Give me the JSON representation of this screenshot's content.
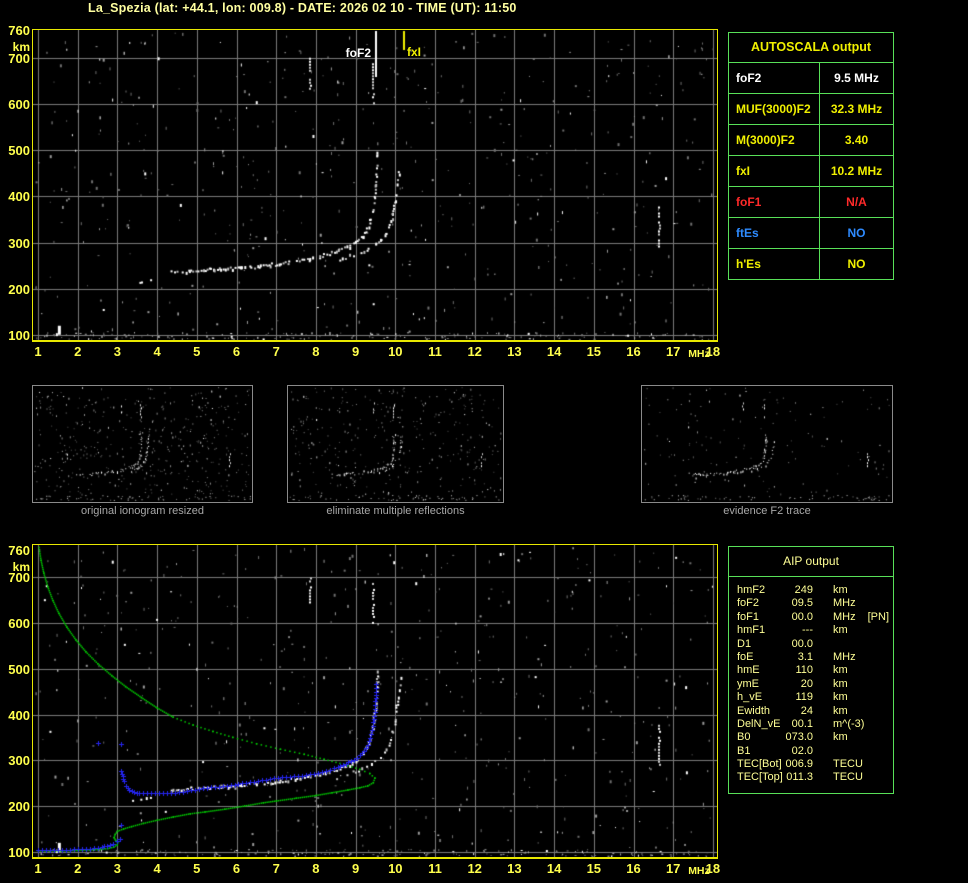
{
  "title": "La_Spezia (lat: +44.1, lon: 009.8) - DATE: 2026 02 10 - TIME (UT): 11:50",
  "colors": {
    "background": "#000000",
    "plot_border": "#e8e800",
    "grid": "#7b7b7b",
    "axis_label": "#ffff4d",
    "title_text": "#ffffa0",
    "echo_white": "#ffffff",
    "profile_green": "#00cf00",
    "trace_blue": "#2424f0",
    "table_border": "#58e058",
    "caption_gray": "#a8a8a8",
    "aip_text": "#ffff96"
  },
  "autoscala_table": {
    "header": "AUTOSCALA output",
    "rows": [
      {
        "label": "foF2",
        "value": "9.5 MHz",
        "color": "#ffffff"
      },
      {
        "label": "MUF(3000)F2",
        "value": "32.3 MHz",
        "color": "#f0f000"
      },
      {
        "label": "M(3000)F2",
        "value": "3.40",
        "color": "#f0f000"
      },
      {
        "label": "fxI",
        "value": "10.2 MHz",
        "color": "#f0f000"
      },
      {
        "label": "foF1",
        "value": "N/A",
        "color": "#ff2a2a"
      },
      {
        "label": "ftEs",
        "value": "NO",
        "color": "#2e8bff"
      },
      {
        "label": "h'Es",
        "value": "NO",
        "color": "#f0f000"
      }
    ]
  },
  "aip_table": {
    "header": "AIP output",
    "rows": [
      {
        "label": "hmF2",
        "value": "249",
        "unit": "km",
        "extra": ""
      },
      {
        "label": "foF2",
        "value": "09.5",
        "unit": "MHz",
        "extra": ""
      },
      {
        "label": "foF1",
        "value": "00.0",
        "unit": "MHz",
        "extra": "[PN]"
      },
      {
        "label": "hmF1",
        "value": "---",
        "unit": "km",
        "extra": ""
      },
      {
        "label": "D1",
        "value": "00.0",
        "unit": "",
        "extra": ""
      },
      {
        "label": "foE",
        "value": "3.1",
        "unit": "MHz",
        "extra": ""
      },
      {
        "label": "hmE",
        "value": "110",
        "unit": "km",
        "extra": ""
      },
      {
        "label": "ymE",
        "value": "20",
        "unit": "km",
        "extra": ""
      },
      {
        "label": "h_vE",
        "value": "119",
        "unit": "km",
        "extra": ""
      },
      {
        "label": "Ewidth",
        "value": "24",
        "unit": "km",
        "extra": ""
      },
      {
        "label": "DelN_vE",
        "value": "00.1",
        "unit": "m^(-3)",
        "extra": ""
      },
      {
        "label": "B0",
        "value": "073.0",
        "unit": "km",
        "extra": ""
      },
      {
        "label": "B1",
        "value": "02.0",
        "unit": "",
        "extra": ""
      },
      {
        "label": "TEC[Bot]",
        "value": "006.9",
        "unit": "TECU",
        "extra": ""
      },
      {
        "label": "TEC[Top]",
        "value": "011.3",
        "unit": "TECU",
        "extra": ""
      }
    ]
  },
  "thumbnails": [
    {
      "caption": "original ionogram resized",
      "noise": 430
    },
    {
      "caption": "eliminate multiple reflections",
      "noise": 340
    },
    {
      "caption": "evidence F2 trace",
      "noise": 130
    }
  ],
  "noise": {
    "speckles": 520,
    "clutter": 190,
    "top_seed": 11,
    "bottom_seed": 77,
    "thumb_seeds": [
      21,
      22,
      23
    ]
  },
  "chart_data": [
    {
      "id": "ionogram-top",
      "type": "scatter",
      "title": "",
      "xlabel": "frequency",
      "x_unit": "MHz",
      "ylabel": "virtual height",
      "y_unit": "km",
      "xlim": [
        1,
        18
      ],
      "ylim": [
        100,
        760
      ],
      "x_ticks": [
        1,
        2,
        3,
        4,
        5,
        6,
        7,
        8,
        9,
        10,
        11,
        12,
        13,
        14,
        15,
        16,
        17,
        18
      ],
      "y_ticks": [
        760,
        700,
        600,
        500,
        400,
        300,
        200,
        100
      ],
      "grid": true,
      "markers": [
        {
          "label": "foF2",
          "x": 9.5,
          "color": "#ffffff"
        },
        {
          "label": "fxI",
          "x": 10.2,
          "color": "#f0f000"
        }
      ],
      "series": [
        {
          "name": "F2 ordinary trace low segment",
          "color": "#ffffff",
          "points": [
            [
              3.4,
              213
            ],
            [
              3.6,
              215
            ],
            [
              3.85,
              216
            ]
          ]
        },
        {
          "name": "F2 ordinary trace",
          "color": "#ffffff",
          "points": [
            [
              4.35,
              235
            ],
            [
              4.6,
              237
            ],
            [
              4.85,
              238
            ],
            [
              5.1,
              240
            ],
            [
              5.35,
              241
            ],
            [
              5.6,
              242
            ],
            [
              5.85,
              243
            ],
            [
              6.1,
              244
            ],
            [
              6.35,
              246
            ],
            [
              6.6,
              248
            ],
            [
              6.85,
              251
            ],
            [
              7.1,
              254
            ],
            [
              7.35,
              257
            ],
            [
              7.6,
              260
            ],
            [
              7.85,
              264
            ],
            [
              8.1,
              269
            ],
            [
              8.35,
              275
            ],
            [
              8.6,
              282
            ],
            [
              8.85,
              291
            ],
            [
              9.05,
              301
            ],
            [
              9.2,
              314
            ],
            [
              9.3,
              329
            ],
            [
              9.38,
              347
            ],
            [
              9.44,
              369
            ],
            [
              9.48,
              394
            ],
            [
              9.52,
              424
            ],
            [
              9.55,
              458
            ],
            [
              9.57,
              495
            ]
          ]
        },
        {
          "name": "F2 extraordinary trace",
          "color": "#ffffff",
          "points": [
            [
              8.55,
              262
            ],
            [
              8.75,
              267
            ],
            [
              8.95,
              273
            ],
            [
              9.15,
              280
            ],
            [
              9.35,
              288
            ],
            [
              9.5,
              296
            ],
            [
              9.65,
              307
            ],
            [
              9.78,
              321
            ],
            [
              9.88,
              339
            ],
            [
              9.95,
              361
            ],
            [
              10.0,
              386
            ],
            [
              10.05,
              417
            ],
            [
              10.1,
              452
            ],
            [
              10.14,
              490
            ]
          ]
        },
        {
          "name": "vertical interference streaks",
          "color": "#e8e8e8",
          "streaks": [
            {
              "x": 7.85,
              "from": 635,
              "to": 700
            },
            {
              "x": 9.45,
              "from": 598,
              "to": 688
            },
            {
              "x": 16.65,
              "from": 288,
              "to": 378
            }
          ]
        }
      ]
    },
    {
      "id": "ionogram-bottom-aip",
      "type": "scatter",
      "title": "",
      "xlabel": "frequency",
      "x_unit": "MHz",
      "ylabel": "height",
      "y_unit": "km",
      "xlim": [
        1,
        18
      ],
      "ylim": [
        100,
        760
      ],
      "x_ticks": [
        1,
        2,
        3,
        4,
        5,
        6,
        7,
        8,
        9,
        10,
        11,
        12,
        13,
        14,
        15,
        16,
        17,
        18
      ],
      "y_ticks": [
        760,
        700,
        600,
        500,
        400,
        300,
        200,
        100
      ],
      "grid": true,
      "note": "ionogram echoes identical to top chart series",
      "series": [
        {
          "name": "electron density profile topside solid",
          "color": "#00cf00",
          "style": "solid",
          "points": [
            [
              1.02,
              766
            ],
            [
              1.07,
              738
            ],
            [
              1.14,
              710
            ],
            [
              1.24,
              680
            ],
            [
              1.37,
              650
            ],
            [
              1.52,
              622
            ],
            [
              1.72,
              592
            ],
            [
              1.95,
              564
            ],
            [
              2.2,
              538
            ],
            [
              2.5,
              512
            ],
            [
              2.85,
              486
            ],
            [
              3.2,
              462
            ],
            [
              3.6,
              438
            ],
            [
              4.0,
              415
            ],
            [
              4.4,
              395
            ]
          ]
        },
        {
          "name": "electron density profile topside dotted",
          "color": "#00cf00",
          "style": "dotted",
          "points": [
            [
              4.4,
              395
            ],
            [
              4.9,
              378
            ],
            [
              5.4,
              364
            ],
            [
              5.9,
              351
            ],
            [
              6.5,
              337
            ],
            [
              7.1,
              325
            ],
            [
              7.7,
              314
            ],
            [
              8.2,
              303
            ],
            [
              8.7,
              292
            ],
            [
              9.1,
              281
            ],
            [
              9.35,
              272
            ],
            [
              9.48,
              262
            ]
          ]
        },
        {
          "name": "electron density profile bottomside",
          "color": "#00cf00",
          "style": "solid",
          "points": [
            [
              9.48,
              262
            ],
            [
              9.44,
              252
            ],
            [
              9.3,
              245
            ],
            [
              9.1,
              241
            ],
            [
              8.8,
              236
            ],
            [
              8.4,
              230
            ],
            [
              8.0,
              224
            ],
            [
              7.5,
              218
            ],
            [
              7.0,
              212
            ],
            [
              6.67,
              208
            ],
            [
              6.2,
              201
            ],
            [
              5.7,
              194
            ],
            [
              5.2,
              188
            ],
            [
              4.83,
              184
            ],
            [
              4.4,
              177
            ],
            [
              4.0,
              170
            ],
            [
              3.65,
              163
            ],
            [
              3.35,
              156
            ],
            [
              3.15,
              151
            ],
            [
              3.0,
              146
            ]
          ]
        },
        {
          "name": "electron density profile E region",
          "color": "#00cf00",
          "style": "solid",
          "points": [
            [
              3.0,
              146
            ],
            [
              2.94,
              139
            ],
            [
              2.91,
              132
            ],
            [
              2.95,
              126
            ],
            [
              3.0,
              121
            ],
            [
              2.99,
              116
            ],
            [
              2.9,
              111
            ],
            [
              2.75,
              108
            ],
            [
              2.55,
              106
            ],
            [
              2.3,
              105
            ],
            [
              2.0,
              104
            ],
            [
              1.6,
              103
            ],
            [
              1.2,
              103
            ],
            [
              1.0,
              103
            ]
          ]
        },
        {
          "name": "autoscaled trace E region",
          "color": "#2424f0",
          "marker": "+",
          "points": [
            [
              1.0,
              104
            ],
            [
              1.2,
              104
            ],
            [
              1.4,
              105
            ],
            [
              1.6,
              105
            ],
            [
              1.8,
              105
            ],
            [
              2.0,
              106
            ],
            [
              2.2,
              107
            ],
            [
              2.4,
              108
            ],
            [
              2.6,
              111
            ],
            [
              2.75,
              114
            ],
            [
              2.9,
              118
            ],
            [
              3.0,
              123
            ],
            [
              3.06,
              128
            ]
          ]
        },
        {
          "name": "autoscaled trace F region",
          "color": "#2424f0",
          "marker": "+",
          "points": [
            [
              3.1,
              277
            ],
            [
              3.13,
              266
            ],
            [
              3.17,
              255
            ],
            [
              3.22,
              245
            ],
            [
              3.3,
              236
            ],
            [
              3.42,
              231
            ],
            [
              3.55,
              229
            ],
            [
              3.75,
              228
            ],
            [
              3.95,
              228
            ],
            [
              4.15,
              228
            ],
            [
              4.35,
              229
            ],
            [
              4.55,
              231
            ],
            [
              4.75,
              233
            ],
            [
              4.95,
              236
            ],
            [
              5.15,
              239
            ],
            [
              5.35,
              241
            ],
            [
              5.55,
              243
            ],
            [
              5.75,
              245
            ],
            [
              5.95,
              247
            ],
            [
              6.15,
              250
            ],
            [
              6.35,
              252
            ],
            [
              6.55,
              255
            ],
            [
              6.75,
              258
            ],
            [
              6.95,
              261
            ],
            [
              7.15,
              263
            ],
            [
              7.35,
              264
            ],
            [
              7.55,
              266
            ],
            [
              7.75,
              268
            ],
            [
              7.95,
              271
            ],
            [
              8.15,
              275
            ],
            [
              8.35,
              280
            ],
            [
              8.55,
              286
            ],
            [
              8.75,
              293
            ],
            [
              8.95,
              302
            ],
            [
              9.1,
              311
            ],
            [
              9.2,
              321
            ],
            [
              9.3,
              334
            ],
            [
              9.37,
              349
            ],
            [
              9.42,
              366
            ],
            [
              9.45,
              384
            ],
            [
              9.48,
              405
            ],
            [
              9.5,
              430
            ],
            [
              9.51,
              450
            ],
            [
              9.52,
              468
            ]
          ]
        },
        {
          "name": "autoscaled trace isolated points",
          "color": "#2424f0",
          "marker": "+",
          "points": [
            [
              2.5,
              338
            ],
            [
              3.1,
              336
            ],
            [
              3.08,
              160
            ]
          ]
        }
      ]
    }
  ]
}
